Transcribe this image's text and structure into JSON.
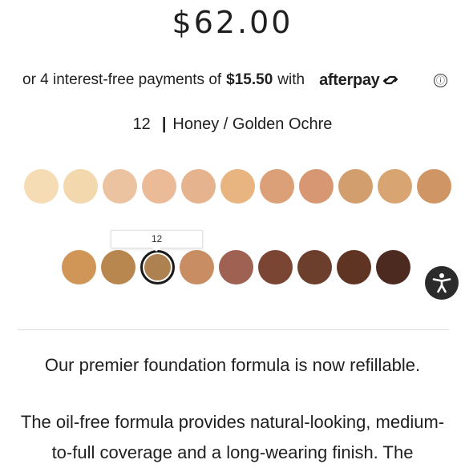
{
  "product": {
    "price": "$62.00"
  },
  "installments": {
    "prefix": "or 4 interest-free payments of",
    "amount": "$15.50",
    "suffix": "with",
    "provider": "afterpay",
    "provider_icon": "afterpay-arrows-icon",
    "info_icon": "ⓘ"
  },
  "shade": {
    "number": "12",
    "separator": "|",
    "name": "Honey / Golden Ochre",
    "tooltip": "12"
  },
  "swatches": {
    "row1": [
      "#f6dcb4",
      "#f3d7ad",
      "#ecc3a0",
      "#ebbb97",
      "#e5b48e",
      "#e8b480",
      "#dca079",
      "#d89773",
      "#d39e6e",
      "#d8a471",
      "#cf9565"
    ],
    "row2": [
      "#cf9658",
      "#b8874f",
      "#ae8150",
      "#c88d63",
      "#9e6152",
      "#7a4532",
      "#6c3e2c",
      "#603423",
      "#4d2a20"
    ],
    "selected_index_row2": 2
  },
  "accessibility": {
    "icon": "accessibility-icon",
    "color": "#2b2b2b"
  },
  "description": {
    "line1": "Our premier foundation formula is now refillable.",
    "line2a": "The oil-free formula provides natural-looking, medium-",
    "line2b": "to-full coverage and a long-wearing finish. The"
  }
}
